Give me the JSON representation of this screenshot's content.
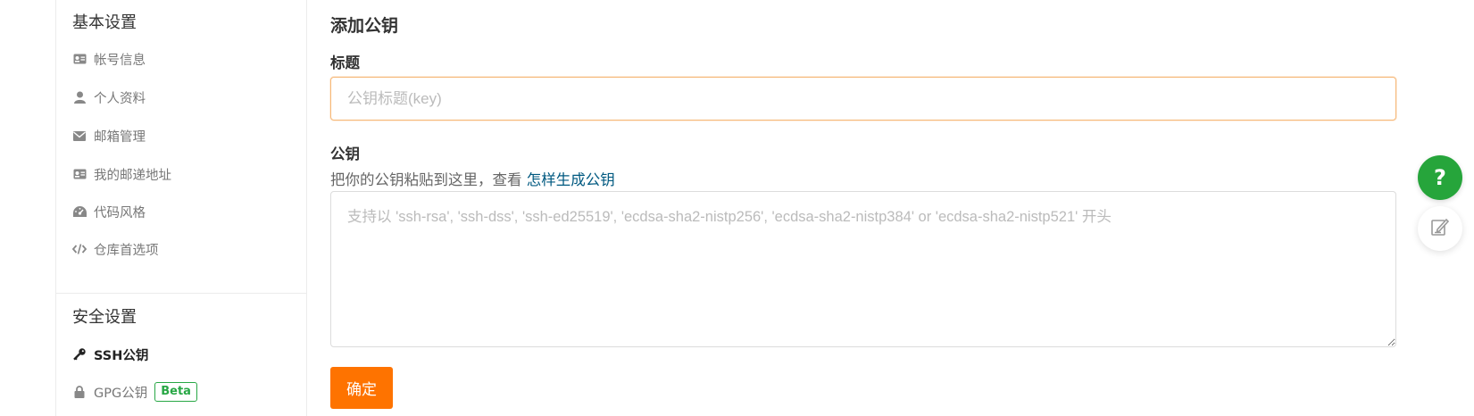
{
  "sidebar": {
    "basic_title": "基本设置",
    "basic_items": [
      {
        "label": "帐号信息",
        "icon": "id-card-icon"
      },
      {
        "label": "个人资料",
        "icon": "user-icon"
      },
      {
        "label": "邮箱管理",
        "icon": "envelope-icon"
      },
      {
        "label": "我的邮递地址",
        "icon": "address-card-icon"
      },
      {
        "label": "代码风格",
        "icon": "dashboard-icon"
      },
      {
        "label": "仓库首选项",
        "icon": "code-icon"
      }
    ],
    "security_title": "安全设置",
    "security_items": [
      {
        "label": "SSH公钥",
        "icon": "key-icon",
        "active": true
      },
      {
        "label": "GPG公钥",
        "icon": "lock-icon",
        "badge": "Beta"
      }
    ]
  },
  "form": {
    "title": "添加公钥",
    "title_label": "标题",
    "title_placeholder": "公钥标题(key)",
    "key_label": "公钥",
    "help_text": "把你的公钥粘贴到这里，查看 ",
    "help_link": "怎样生成公钥",
    "key_placeholder": "支持以 'ssh-rsa', 'ssh-dss', 'ssh-ed25519', 'ecdsa-sha2-nistp256', 'ecdsa-sha2-nistp384' or 'ecdsa-sha2-nistp521' 开头",
    "submit_label": "确定"
  },
  "floating": {
    "help_symbol": "?",
    "edit_icon": "edit-icon"
  },
  "colors": {
    "accent": "#fe7300",
    "link": "#005980",
    "help_button": "#26a53b",
    "badge": "#28a745"
  }
}
